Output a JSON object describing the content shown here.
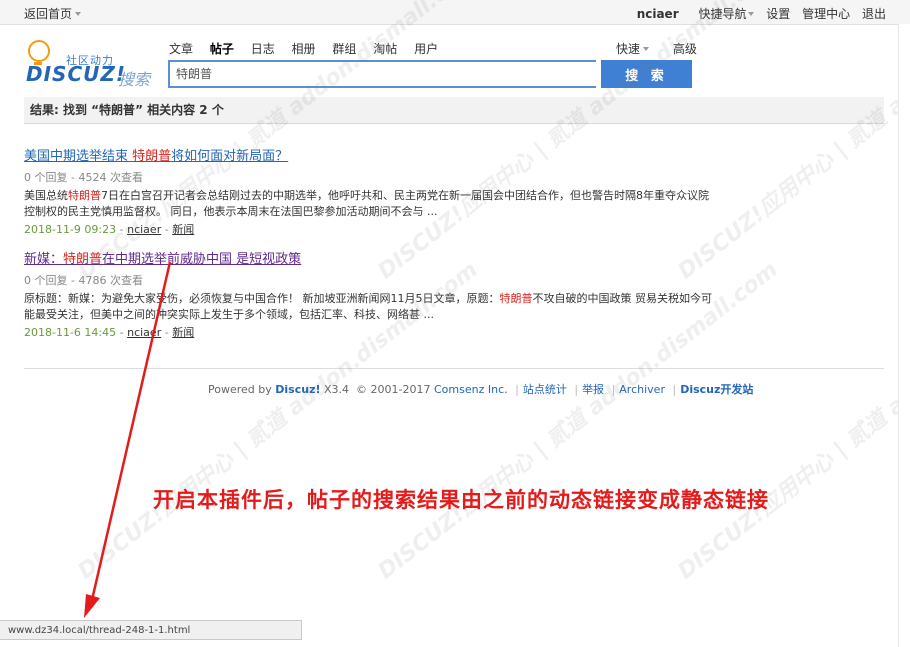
{
  "topbar": {
    "home": "返回首页",
    "user": "nciaer",
    "quick_nav": "快捷导航",
    "settings": "设置",
    "admin": "管理中心",
    "logout": "退出"
  },
  "logo": {
    "tagline": "社区动力",
    "brand": "DISCUZ!",
    "search_word": "搜索"
  },
  "search": {
    "tabs": [
      "文章",
      "帖子",
      "日志",
      "相册",
      "群组",
      "淘帖",
      "用户"
    ],
    "active_tab": "帖子",
    "quick": "快速",
    "advanced": "高级",
    "query": "特朗普",
    "button": "搜 索"
  },
  "results_header": {
    "prefix": "结果: 找到 “",
    "keyword": "特朗普",
    "suffix": "” 相关内容 2 个"
  },
  "results": [
    {
      "title_a": "美国中期选举结束 ",
      "title_hl": "特朗普",
      "title_b": "将如何面对新局面？",
      "stats": "0 个回复 - 4524 次查看",
      "excerpt_a": "美国总统",
      "excerpt_hl": "特朗普",
      "excerpt_b": "7日在白宫召开记者会总结刚过去的中期选举，他呼吁共和、民主两党在新一届国会中团结合作，但也警告时隔8年重夺众议院控制权的民主党慎用监督权。 同日，他表示本周末在法国巴黎参加活动期间不会与 ...",
      "date": "2018-11-9 09:23",
      "author": "nciaer",
      "forum": "新闻"
    },
    {
      "title_a": "新媒：",
      "title_hl": "特朗普",
      "title_b": "在中期选举前威胁中国 是短视政策",
      "stats": "0 个回复 - 4786 次查看",
      "excerpt_a": "原标题：新媒：为避免大家受伤，必须恢复与中国合作！ 新加坡亚洲新闻网11月5日文章，原题：",
      "excerpt_hl": "特朗普",
      "excerpt_b": "不攻自破的中国政策 贸易关税如今可能最受关注，但美中之间的冲突实际上发生于多个领域，包括汇率、科技、网络甚 ...",
      "date": "2018-11-6 14:45",
      "author": "nciaer",
      "forum": "新闻"
    }
  ],
  "footer": {
    "powered": "Powered by ",
    "product": "Discuz!",
    "version": " X3.4",
    "copyright": "© 2001-2017 ",
    "company": "Comsenz Inc.",
    "stats": "站点统计",
    "report": "举报",
    "archiver": "Archiver",
    "dev": "Discuz开发站"
  },
  "annotation": "开启本插件后，帖子的搜索结果由之前的动态链接变成静态链接",
  "statusbar": "www.dz34.local/thread-248-1-1.html",
  "watermark": "DISCUZ!应用中心 | 贰道 addon.dismall.com",
  "colors": {
    "brand_blue": "#2366b8",
    "highlight_red": "#d9241c",
    "annotation_red": "#e31b1b",
    "date_green": "#6a9a3d"
  }
}
